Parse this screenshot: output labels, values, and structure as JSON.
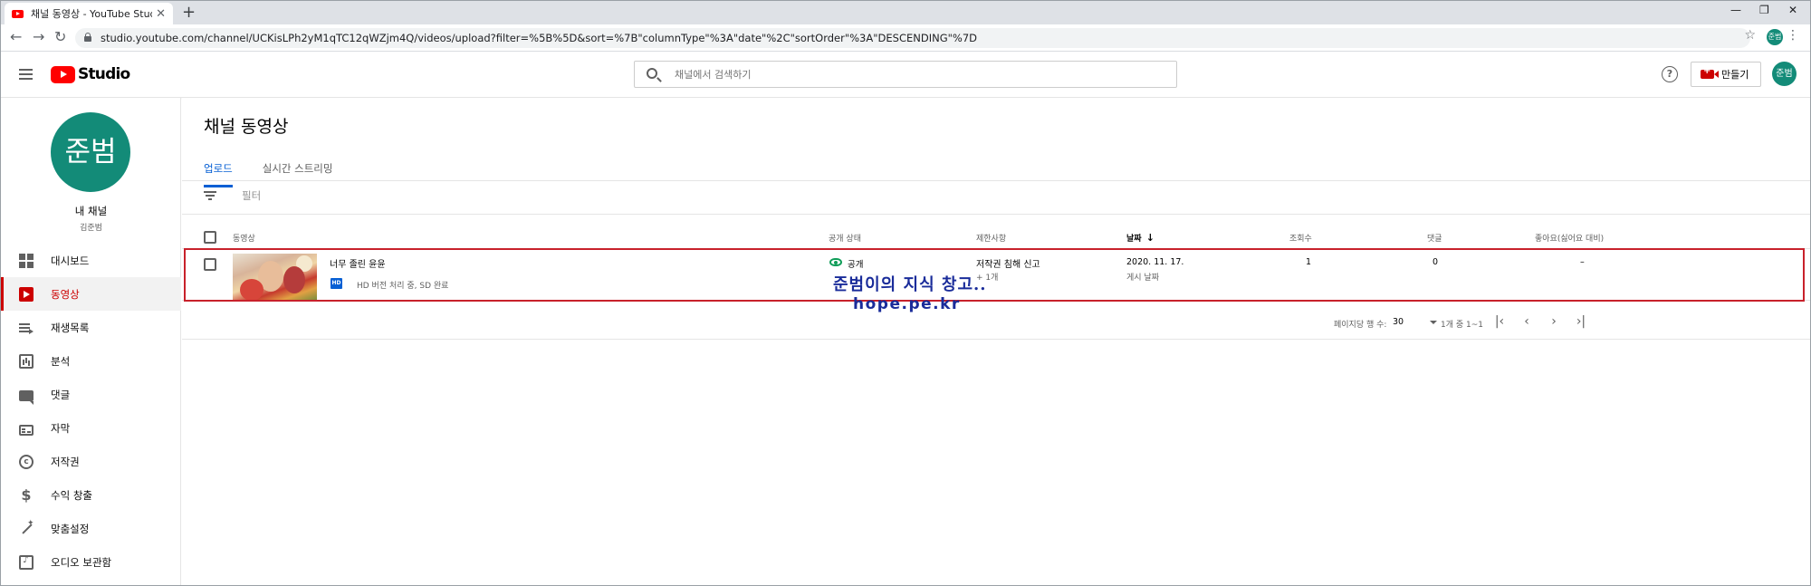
{
  "browser": {
    "tab_title": "채널 동영상 - YouTube Studio",
    "tab_close": "✕",
    "new_tab": "+",
    "window_controls": [
      "—",
      "❐",
      "✕"
    ],
    "nav": [
      "←",
      "→",
      "↻"
    ],
    "url": "studio.youtube.com/channel/UCKisLPh2yM1qTC12qWZjm4Q/videos/upload?filter=%5B%5D&sort=%7B\"columnType\"%3A\"date\"%2C\"sortOrder\"%3A\"DESCENDING\"%7D",
    "star": "☆",
    "profile_initials": "준범",
    "menu": "⋮"
  },
  "header": {
    "logo_text": "Studio",
    "search_placeholder": "채널에서 검색하기",
    "help": "?",
    "create_label": "만들기",
    "avatar_initials": "준범"
  },
  "sidebar": {
    "avatar_text": "준범",
    "channel_label": "내 채널",
    "channel_name": "김준범",
    "items": [
      {
        "label": "대시보드",
        "icon": "dashboard-icon"
      },
      {
        "label": "동영상",
        "icon": "video-icon"
      },
      {
        "label": "재생목록",
        "icon": "playlist-icon"
      },
      {
        "label": "분석",
        "icon": "analytics-icon"
      },
      {
        "label": "댓글",
        "icon": "comment-icon"
      },
      {
        "label": "자막",
        "icon": "subtitles-icon"
      },
      {
        "label": "저작권",
        "icon": "copyright-icon"
      },
      {
        "label": "수익 창출",
        "icon": "money-icon"
      },
      {
        "label": "맞춤설정",
        "icon": "customize-icon"
      },
      {
        "label": "오디오 보관함",
        "icon": "audio-library-icon"
      }
    ],
    "active_index": 1
  },
  "main": {
    "title": "채널 동영상",
    "tabs": [
      "업로드",
      "실시간 스트리밍"
    ],
    "active_tab": 0,
    "filter_label": "필터",
    "columns": {
      "video": "동영상",
      "visibility": "공개 상태",
      "restrictions": "제한사항",
      "date": "날짜",
      "date_sort": "↓",
      "views": "조회수",
      "comments": "댓글",
      "likes": "좋아요(싫어요 대비)"
    },
    "rows": [
      {
        "title": "너무 졸린 윤윤",
        "hd_badge": "HD",
        "status": "HD 버전 처리 중, SD 완료",
        "visibility": "공개",
        "restriction": "저작권 침해 신고",
        "restriction_more": "+ 1개",
        "date": "2020. 11. 17.",
        "date_label": "게시 날짜",
        "views": "1",
        "comments": "0",
        "likes": "–"
      }
    ],
    "pagination": {
      "rows_per_page_label": "페이지당 행 수:",
      "rows_per_page": "30",
      "range": "1개 중 1~1",
      "first": "|‹",
      "prev": "‹",
      "next": "›",
      "last": "›|"
    }
  },
  "watermark": {
    "line1": "준범이의 지식 창고..",
    "line2": "hope.pe.kr"
  },
  "colors": {
    "brand_red": "#ff0000",
    "active_red": "#cc0000",
    "accent_blue": "#065fd4",
    "avatar_teal": "#138b78",
    "highlight_box": "#c8212b",
    "watermark_blue": "#1a2c9a"
  }
}
